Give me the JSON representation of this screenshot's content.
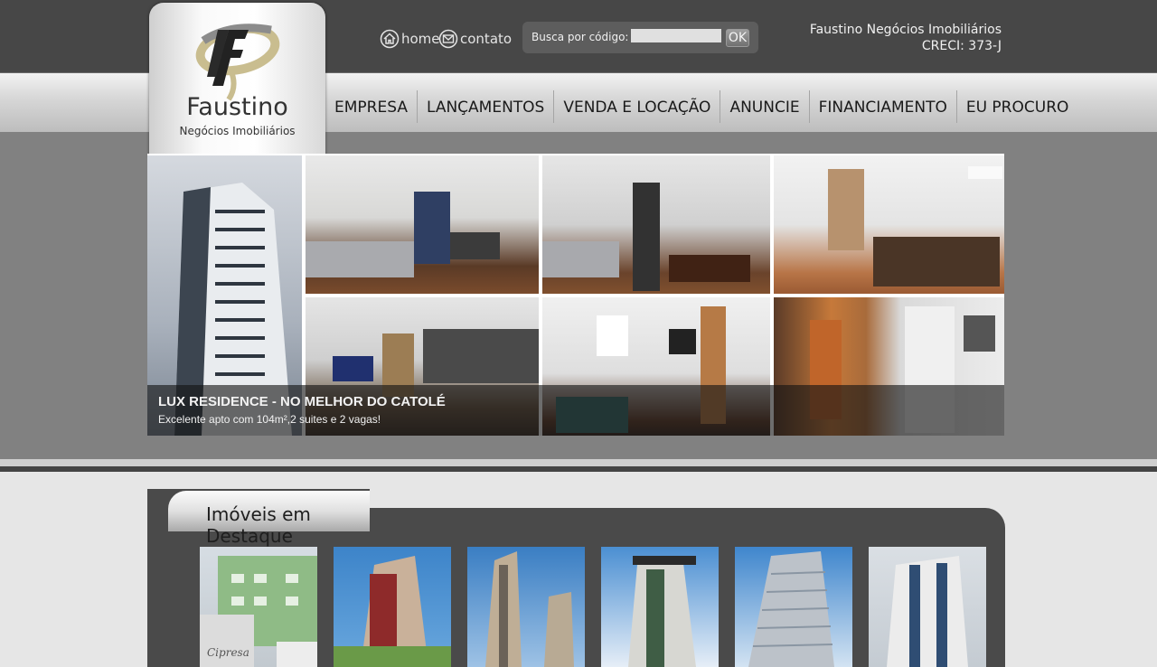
{
  "logo": {
    "name": "Faustino",
    "subtitle": "Negócios Imobiliários",
    "letter": "F"
  },
  "toplinks": {
    "home": "home",
    "contato": "contato"
  },
  "search": {
    "label": "Busca por código:",
    "value": "",
    "button": "OK"
  },
  "company": {
    "name": "Faustino Negócios Imobiliários",
    "creci": "CRECI: 373-J"
  },
  "nav": [
    "EMPRESA",
    "LANÇAMENTOS",
    "VENDA E LOCAÇÃO",
    "ANUNCIE",
    "FINANCIAMENTO",
    "EU PROCURO"
  ],
  "banner": {
    "title": "LUX RESIDENCE - NO MELHOR DO CATOLÉ",
    "subtitle": "Excelente apto com 104m²,2 suites e 2 vagas!"
  },
  "featured": {
    "title": "Imóveis em Destaque",
    "watermark": "Cipresa"
  },
  "colors": {
    "topbar": "#474747",
    "panel": "#4a4a4a",
    "background": "#e6e6e6",
    "logo_gold": "#c8b98a"
  }
}
